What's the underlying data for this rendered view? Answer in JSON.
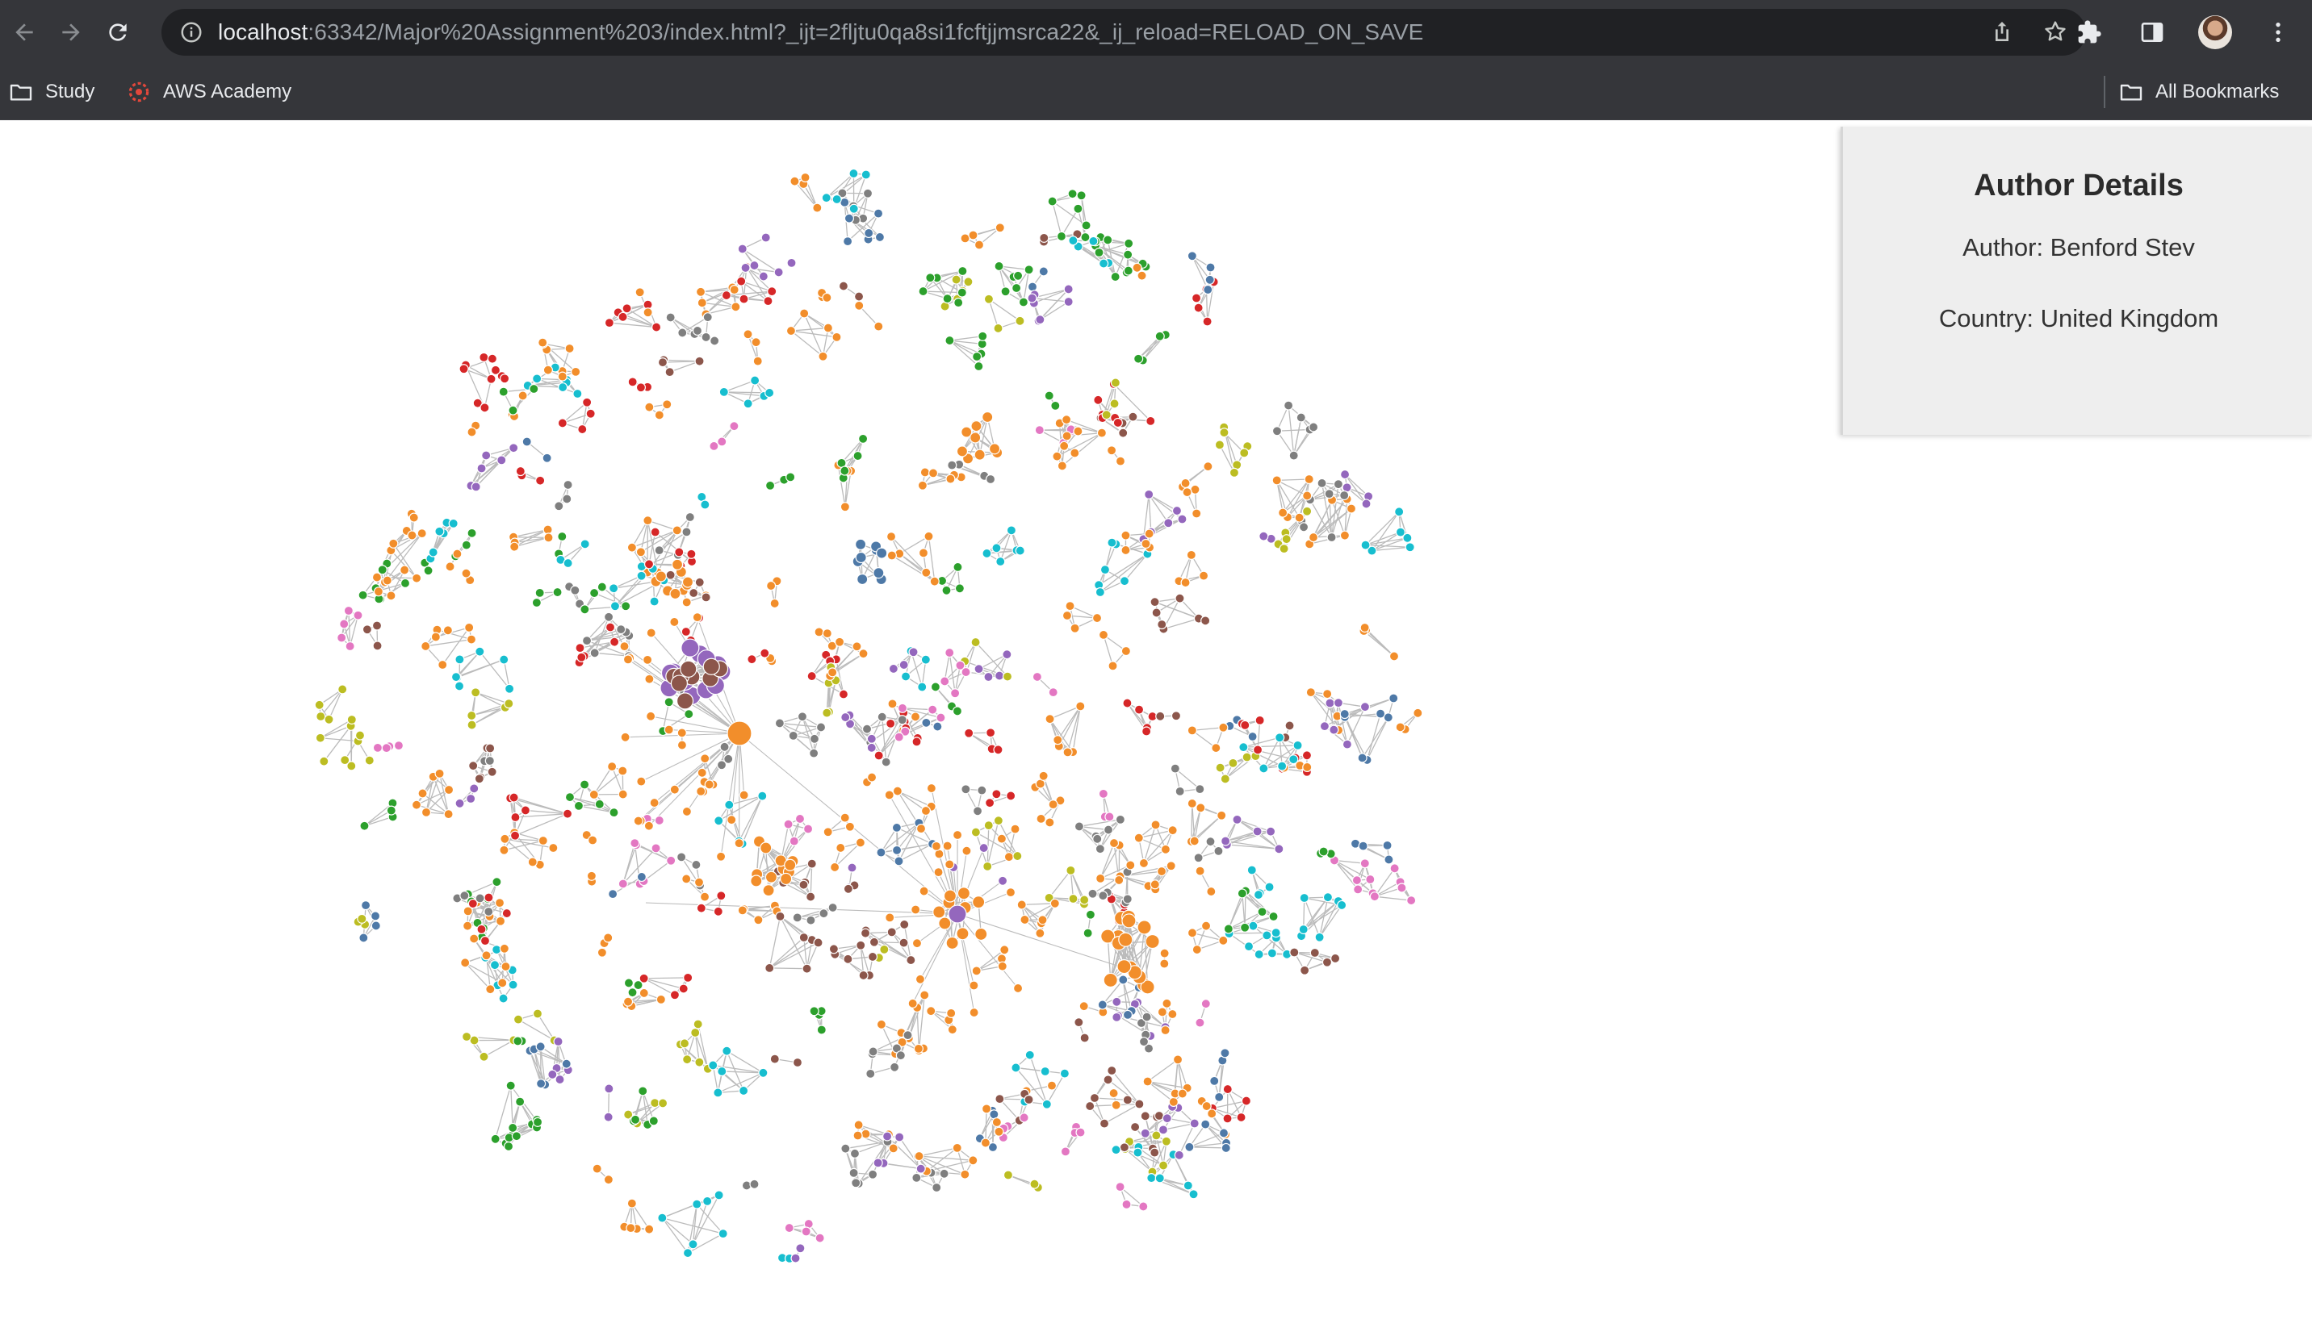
{
  "browser": {
    "url_host": "localhost",
    "url_rest": ":63342/Major%20Assignment%203/index.html?_ijt=2fljtu0qa8si1fcftjjmsrca22&_ij_reload=RELOAD_ON_SAVE",
    "icons": {
      "back": "arrow-left-icon",
      "forward": "arrow-right-icon",
      "reload": "reload-icon",
      "site_info": "info-icon",
      "share": "share-icon",
      "bookmark_star": "star-icon",
      "extensions": "puzzle-icon",
      "side_panel": "side-panel-icon",
      "menu": "kebab-menu-icon"
    }
  },
  "bookmarks_bar": {
    "items": [
      {
        "label": "Study",
        "icon": "folder-icon"
      },
      {
        "label": "AWS Academy",
        "icon": "aws-academy-icon"
      }
    ],
    "all_bookmarks_label": "All Bookmarks"
  },
  "details_panel": {
    "title": "Author Details",
    "author_line": "Author: Benford Stev",
    "country_line": "Country: United Kingdom"
  },
  "network": {
    "node_colors": [
      "#f28e2b",
      "#f28e2b",
      "#f28e2b",
      "#f28e2b",
      "#9467bd",
      "#4e79a7",
      "#8c564b",
      "#7f7f7f",
      "#bcbd22",
      "#e377c2",
      "#d62728",
      "#2ca02c",
      "#17becf"
    ],
    "edge_color": "#bbbbbb",
    "hub_colors": [
      "#9467bd",
      "#8c564b",
      "#4e79a7",
      "#f28e2b"
    ]
  }
}
